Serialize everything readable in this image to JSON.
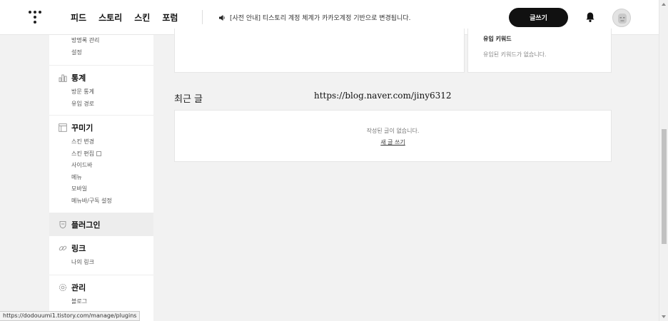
{
  "header": {
    "nav": [
      "피드",
      "스토리",
      "스킨",
      "포럼"
    ],
    "notice": "[사전 안내] 티스토리 계정 체계가 카카오계정 기반으로 변경됩니다.",
    "write_button": "글쓰기"
  },
  "sidebar": {
    "top_items": [
      "방명록 관리",
      "설정"
    ],
    "groups": [
      {
        "title": "통계",
        "icon": "chart-icon",
        "items": [
          "방문 통계",
          "유입 경로"
        ]
      },
      {
        "title": "꾸미기",
        "icon": "layout-icon",
        "items": [
          "스킨 변경",
          "스킨 편집",
          "사이드바",
          "메뉴",
          "모바일",
          "메뉴바/구독 설정"
        ]
      },
      {
        "title": "플러그인",
        "icon": "plugin-icon",
        "items": []
      },
      {
        "title": "링크",
        "icon": "link-icon",
        "items": [
          "나의 링크"
        ]
      },
      {
        "title": "관리",
        "icon": "gear-icon",
        "items": [
          "블로그"
        ]
      }
    ]
  },
  "main": {
    "keywords_title": "유입 키워드",
    "keywords_empty": "유입된 키워드가 없습니다.",
    "recent_title": "최근 글",
    "url_overlay": "https://blog.naver.com/jiny6312",
    "posts_empty": "작성된 글이 없습니다.",
    "new_post_link": "새 글 쓰기"
  },
  "status_bar": {
    "url": "https://dodouumi1.tistory.com/manage/plugins"
  }
}
